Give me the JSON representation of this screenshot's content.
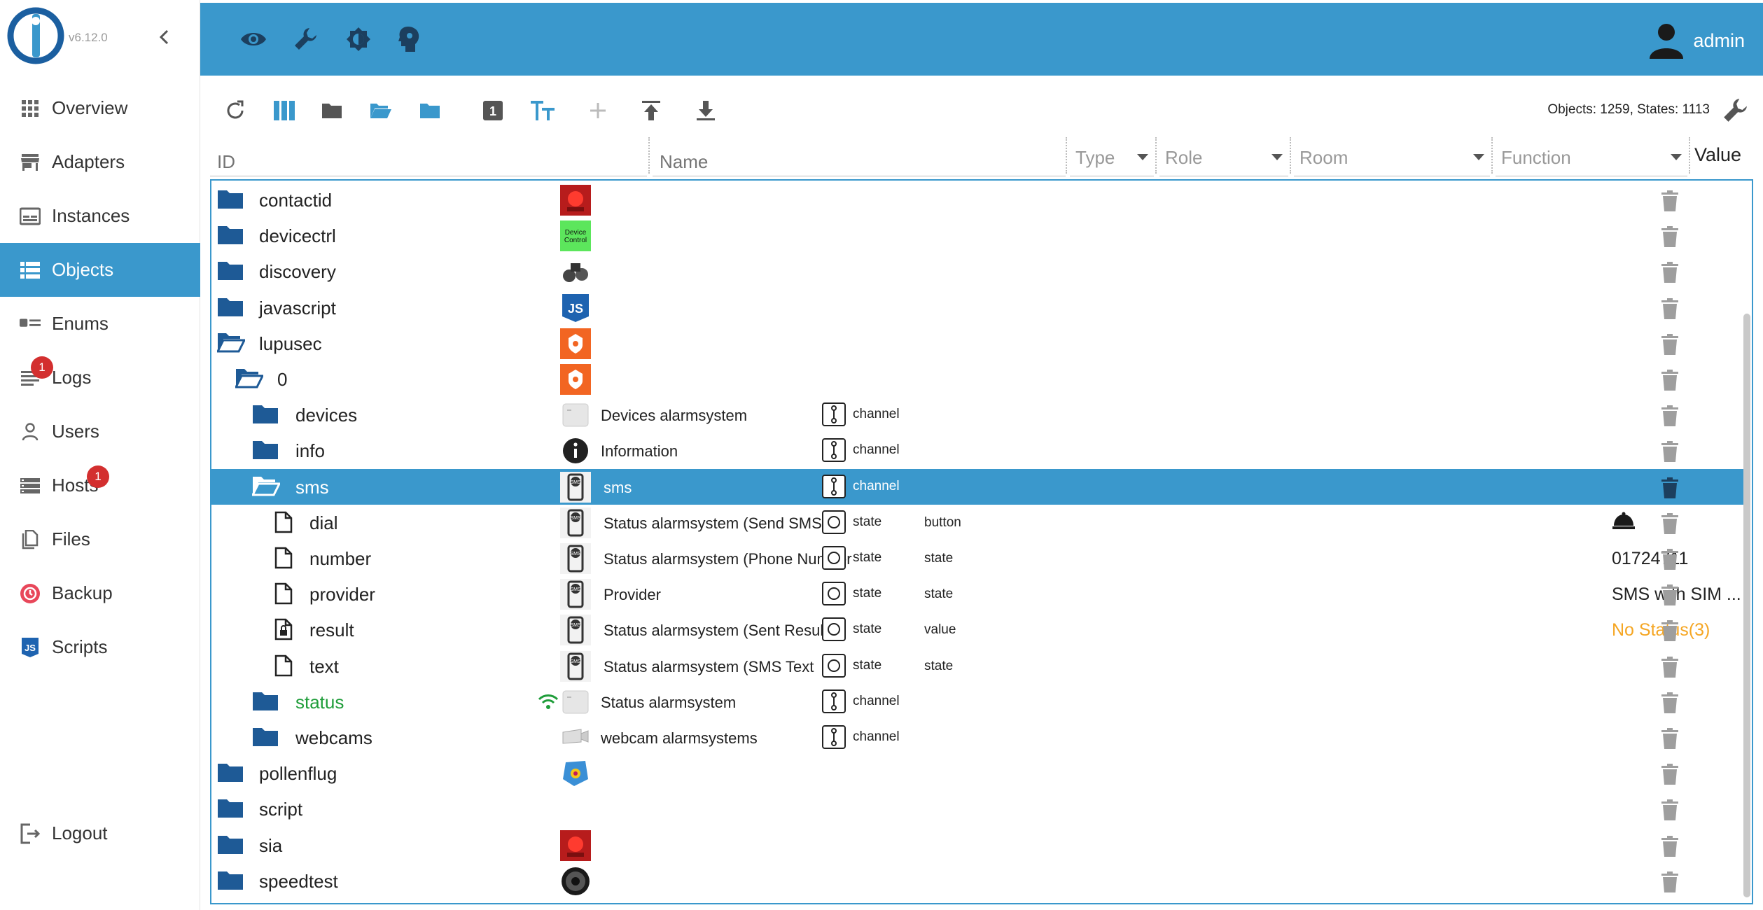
{
  "app": {
    "version": "v6.12.0",
    "user_name": "admin"
  },
  "sidebar": {
    "items": [
      {
        "label": "Overview",
        "icon": "grid-icon"
      },
      {
        "label": "Adapters",
        "icon": "store-icon"
      },
      {
        "label": "Instances",
        "icon": "instances-icon"
      },
      {
        "label": "Objects",
        "icon": "list-icon",
        "active": true
      },
      {
        "label": "Enums",
        "icon": "enum-icon"
      },
      {
        "label": "Logs",
        "icon": "logs-icon",
        "badge": "1"
      },
      {
        "label": "Users",
        "icon": "user-icon"
      },
      {
        "label": "Hosts",
        "icon": "hosts-icon",
        "badge": "1"
      },
      {
        "label": "Files",
        "icon": "files-icon"
      },
      {
        "label": "Backup",
        "icon": "backup-icon"
      },
      {
        "label": "Scripts",
        "icon": "js-icon"
      }
    ],
    "logout_label": "Logout"
  },
  "toolbar": {
    "counts": "Objects: 1259, States: 1113",
    "count_badge": "1"
  },
  "columns": {
    "id_placeholder": "ID",
    "name_placeholder": "Name",
    "type": "Type",
    "role": "Role",
    "room": "Room",
    "function": "Function",
    "value": "Value"
  },
  "colors": {
    "accent": "#3a98cc",
    "folder": "#1e5a96",
    "status_green": "#1f9d3a",
    "value_orange": "#f5a623",
    "badge_red": "#d32f2f"
  },
  "rows": [
    {
      "id": "contactid",
      "level": 0,
      "icon": "folder-icon",
      "img": "red-alarm"
    },
    {
      "id": "devicectrl",
      "level": 0,
      "icon": "folder-icon",
      "img": "device-control"
    },
    {
      "id": "discovery",
      "level": 0,
      "icon": "folder-icon",
      "img": "binoculars"
    },
    {
      "id": "javascript",
      "level": 0,
      "icon": "folder-icon",
      "img": "js"
    },
    {
      "id": "lupusec",
      "level": 0,
      "icon": "folder-open-icon",
      "img": "lupus"
    },
    {
      "id": "0",
      "level": 1,
      "icon": "folder-open-icon",
      "img": "lupus"
    },
    {
      "id": "devices",
      "level": 2,
      "icon": "folder-icon",
      "img": "device-box",
      "name": "Devices alarmsystem",
      "type": "channel"
    },
    {
      "id": "info",
      "level": 2,
      "icon": "folder-icon",
      "img": "info",
      "name": "Information",
      "type": "channel"
    },
    {
      "id": "sms",
      "level": 2,
      "icon": "folder-open-icon",
      "img": "sms",
      "name": "sms",
      "type": "channel",
      "selected": true
    },
    {
      "id": "dial",
      "level": 3,
      "icon": "file-icon",
      "img": "sms",
      "name": "Status alarmsystem (Send SMS",
      "type": "state",
      "role": "button",
      "value_icon": "bell-icon"
    },
    {
      "id": "number",
      "level": 3,
      "icon": "file-icon",
      "img": "sms",
      "name": "Status alarmsystem (Phone Number",
      "type": "state",
      "role": "state",
      "value": "01724711"
    },
    {
      "id": "provider",
      "level": 3,
      "icon": "file-icon",
      "img": "sms",
      "name": "Provider",
      "type": "state",
      "role": "state",
      "value": "SMS with SIM ..."
    },
    {
      "id": "result",
      "level": 3,
      "icon": "file-lock-icon",
      "img": "sms",
      "name": "Status alarmsystem (Sent Result",
      "type": "state",
      "role": "value",
      "value": "No Status(3)",
      "value_color": "orange"
    },
    {
      "id": "text",
      "level": 3,
      "icon": "file-icon",
      "img": "sms",
      "name": "Status alarmsystem (SMS Text",
      "type": "state",
      "role": "state"
    },
    {
      "id": "status",
      "level": 2,
      "icon": "folder-icon",
      "img": "device-box",
      "name": "Status alarmsystem",
      "type": "channel",
      "id_color": "green",
      "wifi": true
    },
    {
      "id": "webcams",
      "level": 2,
      "icon": "folder-icon",
      "img": "webcam",
      "name": "webcam alarmsystems",
      "type": "channel"
    },
    {
      "id": "pollenflug",
      "level": 0,
      "icon": "folder-icon",
      "img": "pollen"
    },
    {
      "id": "script",
      "level": 0,
      "icon": "folder-icon"
    },
    {
      "id": "sia",
      "level": 0,
      "icon": "folder-icon",
      "img": "red-alarm"
    },
    {
      "id": "speedtest",
      "level": 0,
      "icon": "folder-icon",
      "img": "speedometer"
    }
  ]
}
